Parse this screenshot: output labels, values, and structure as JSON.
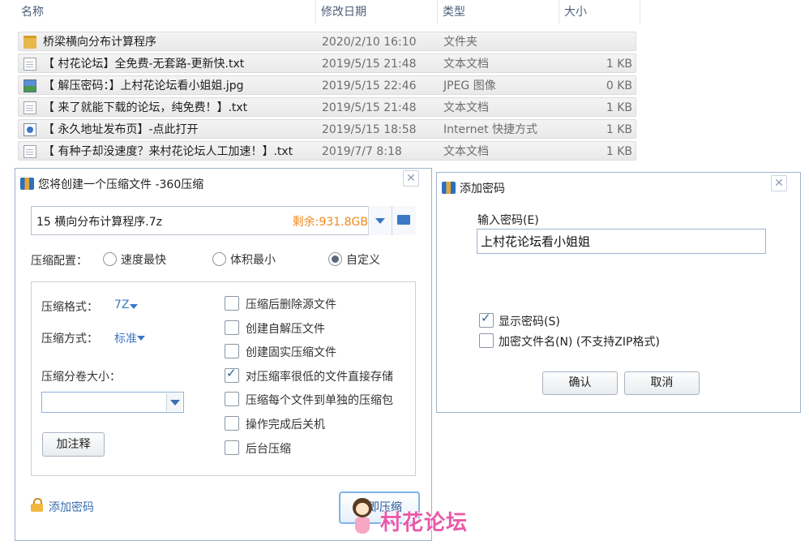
{
  "explorer": {
    "columns": {
      "name": "名称",
      "modified": "修改日期",
      "type": "类型",
      "size": "大小"
    },
    "rows": [
      {
        "icon": "folder-icon",
        "name": "桥梁横向分布计算程序",
        "date": "2020/2/10 16:10",
        "type": "文件夹",
        "size": ""
      },
      {
        "icon": "text-file-icon",
        "name": "【 村花论坛】全免费-无套路-更新快.txt",
        "date": "2019/5/15 21:48",
        "type": "文本文档",
        "size": "1 KB"
      },
      {
        "icon": "image-file-icon",
        "name": "【 解压密码：】上村花论坛看小姐姐.jpg",
        "date": "2019/5/15 22:46",
        "type": "JPEG 图像",
        "size": "0 KB"
      },
      {
        "icon": "text-file-icon",
        "name": "【 来了就能下载的论坛，纯免费！】.txt",
        "date": "2019/5/15 21:48",
        "type": "文本文档",
        "size": "1 KB"
      },
      {
        "icon": "internet-shortcut-icon",
        "name": "【 永久地址发布页】-点此打开",
        "date": "2019/5/15 18:58",
        "type": "Internet 快捷方式",
        "size": "1 KB"
      },
      {
        "icon": "text-file-icon",
        "name": "【 有种子却没速度？来村花论坛人工加速！】.txt",
        "date": "2019/7/7 8:18",
        "type": "文本文档",
        "size": "1 KB"
      }
    ]
  },
  "compress_dialog": {
    "title": "您将创建一个压缩文件 -360压缩",
    "close": "✕",
    "path_value": "15 横向分布计算程序.7z",
    "free_space": "剩余:931.8GB",
    "config_label": "压缩配置：",
    "radios": [
      {
        "label": "速度最快",
        "checked": false
      },
      {
        "label": "体积最小",
        "checked": false
      },
      {
        "label": "自定义",
        "checked": true
      }
    ],
    "format_label": "压缩格式：",
    "format_value": "7Z",
    "method_label": "压缩方式：",
    "method_value": "标准",
    "volume_label": "压缩分卷大小：",
    "volume_value": "",
    "comment_button": "加注释",
    "options": [
      {
        "label": "压缩后删除源文件",
        "checked": false
      },
      {
        "label": "创建自解压文件",
        "checked": false
      },
      {
        "label": "创建固实压缩文件",
        "checked": false
      },
      {
        "label": "对压缩率很低的文件直接存储",
        "checked": true
      },
      {
        "label": "压缩每个文件到单独的压缩包",
        "checked": false
      },
      {
        "label": "操作完成后关机",
        "checked": false
      },
      {
        "label": "后台压缩",
        "checked": false
      }
    ],
    "add_password": "添加密码",
    "start_button": "立即压缩",
    "watermark_text": "村花论坛"
  },
  "password_dialog": {
    "title": "添加密码",
    "close": "✕",
    "input_label": "输入密码(E)",
    "input_value": "上村花论坛看小姐姐",
    "show_password": {
      "label": "显示密码(S)",
      "checked": true
    },
    "encrypt_names": {
      "label": "加密文件名(N) (不支持ZIP格式)",
      "checked": false
    },
    "ok_button": "确认",
    "cancel_button": "取消"
  }
}
